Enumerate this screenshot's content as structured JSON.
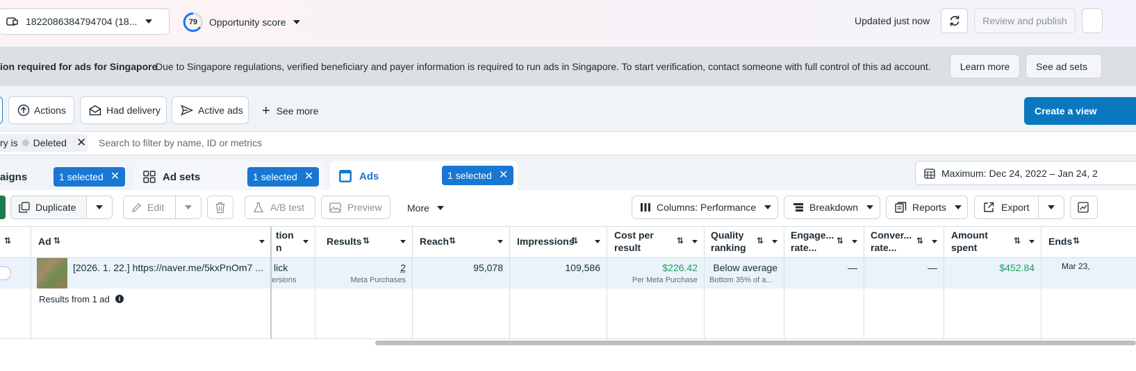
{
  "topbar": {
    "account_label": "1822086384794704 (18...",
    "opportunity_score": "79",
    "opportunity_label": "Opportunity score",
    "updated_text": "Updated just now",
    "review_publish_label": "Review and publish"
  },
  "banner": {
    "title": "ion required for ads for Singapore",
    "message": "Due to Singapore regulations, verified beneficiary and payer information is required to run ads in Singapore. To start verification, contact someone with full control of this ad account.",
    "learn_more_label": "Learn more",
    "see_ad_sets_label": "See ad sets"
  },
  "filters": {
    "actions_label": "Actions",
    "had_delivery_label": "Had delivery",
    "active_ads_label": "Active ads",
    "see_more_label": "See more",
    "create_view_label": "Create a view"
  },
  "search": {
    "chip_prefix": "ry is",
    "chip_value": "Deleted",
    "placeholder": "Search to filter by name, ID or metrics"
  },
  "tabs": {
    "campaigns_label": "aigns",
    "campaigns_selected": "1 selected",
    "adsets_label": "Ad sets",
    "adsets_selected": "1 selected",
    "ads_label": "Ads",
    "ads_selected": "1 selected",
    "date_range": "Maximum: Dec 24, 2022 – Jan 24, 2"
  },
  "toolbar": {
    "duplicate_label": "Duplicate",
    "edit_label": "Edit",
    "ab_test_label": "A/B test",
    "preview_label": "Preview",
    "more_label": "More",
    "columns_label": "Columns: Performance",
    "breakdown_label": "Breakdown",
    "reports_label": "Reports",
    "export_label": "Export"
  },
  "table": {
    "headers": {
      "ad": "Ad",
      "attribution_1": "tion",
      "attribution_2": "n",
      "results": "Results",
      "reach": "Reach",
      "impressions": "Impressions",
      "cost_per_result_1": "Cost per",
      "cost_per_result_2": "result",
      "quality_1": "Quality",
      "quality_2": "ranking",
      "engage_1": "Engage...",
      "engage_2": "rate...",
      "conver_1": "Conver...",
      "conver_2": "rate...",
      "amount_1": "Amount",
      "amount_2": "spent",
      "ends": "Ends"
    },
    "row": {
      "ad_name": "[2026. 1. 22.] https://naver.me/5kxPnOm7 ...",
      "attribution_1": "lick",
      "attribution_2": "ersions",
      "results": "2",
      "results_sub": "Meta Purchases",
      "reach": "95,078",
      "impressions": "109,586",
      "cost_per_result": "$226.42",
      "cost_sub": "Per Meta Purchase",
      "quality": "Below average",
      "quality_sub": "Bottom 35% of a...",
      "engage": "—",
      "conver": "—",
      "amount_spent": "$452.84",
      "ends": "Mar 23,"
    },
    "summary": "Results from 1 ad"
  }
}
